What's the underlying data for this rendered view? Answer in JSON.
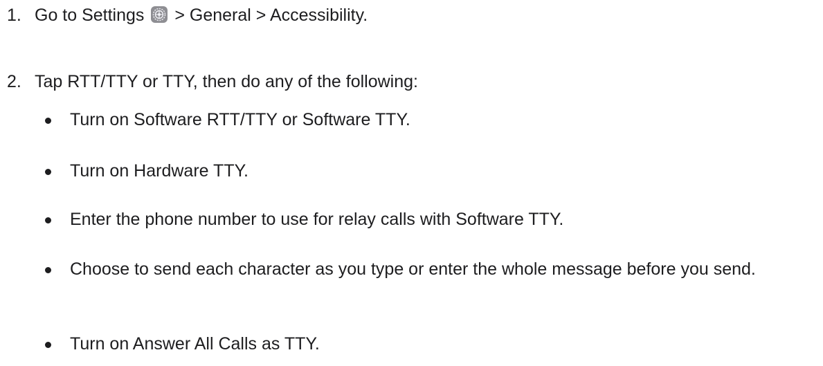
{
  "steps": [
    {
      "number": "1.",
      "text_before_icon": "Go to Settings",
      "icon": "settings-gear-icon",
      "text_after_icon": "> General > Accessibility."
    },
    {
      "number": "2.",
      "text": "Tap RTT/TTY or TTY, then do any of the following:"
    }
  ],
  "bullets": [
    "Turn on Software RTT/TTY or Software TTY.",
    "Turn on Hardware TTY.",
    "Enter the phone number to use for relay calls with Software TTY.",
    "Choose to send each character as you type or enter the whole message before you send.",
    "Turn on Answer All Calls as TTY."
  ],
  "colors": {
    "text": "#1d1d1f",
    "icon_gray": "#8e8e93"
  }
}
